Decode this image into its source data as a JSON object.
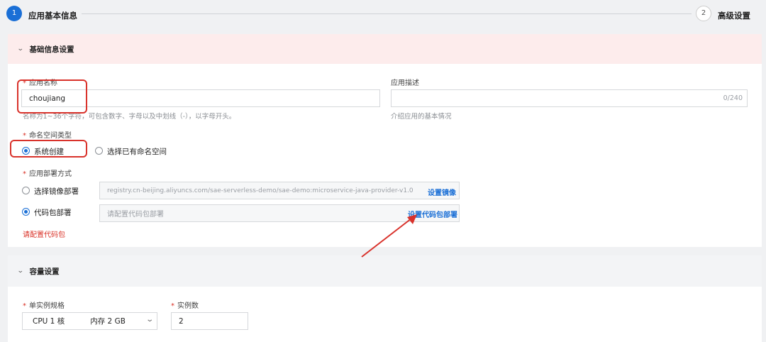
{
  "steps": [
    {
      "number": "1",
      "label": "应用基本信息"
    },
    {
      "number": "2",
      "label": "高级设置"
    }
  ],
  "basic_section": {
    "title": "基础信息设置",
    "app_name": {
      "label": "应用名称",
      "value": "choujiang",
      "hint": "名称为1~36个字符，可包含数字、字母以及中划线（-），以字母开头。"
    },
    "app_desc": {
      "label": "应用描述",
      "counter": "0/240",
      "hint": "介绍应用的基本情况"
    },
    "namespace": {
      "label": "命名空间类型",
      "options": [
        "系统创建",
        "选择已有命名空间"
      ],
      "selected": "系统创建"
    },
    "deploy": {
      "label": "应用部署方式",
      "image_option": "选择镜像部署",
      "image_value": "registry.cn-beijing.aliyuncs.com/sae-serverless-demo/sae-demo:microservice-java-provider-v1.0",
      "image_link": "设置镜像",
      "code_option": "代码包部署",
      "code_placeholder": "请配置代码包部署",
      "code_link": "设置代码包部署",
      "selected": "代码包部署",
      "error": "请配置代码包"
    }
  },
  "capacity_section": {
    "title": "容量设置",
    "spec_label": "单实例规格",
    "spec_cpu": "CPU 1 核",
    "spec_mem": "内存 2 GB",
    "instances_label": "实例数",
    "instances_value": "2"
  },
  "colors": {
    "accent": "#1a6fd6",
    "error": "#d93026",
    "annotation": "#d9322b",
    "section_highlight": "#fdecec"
  }
}
